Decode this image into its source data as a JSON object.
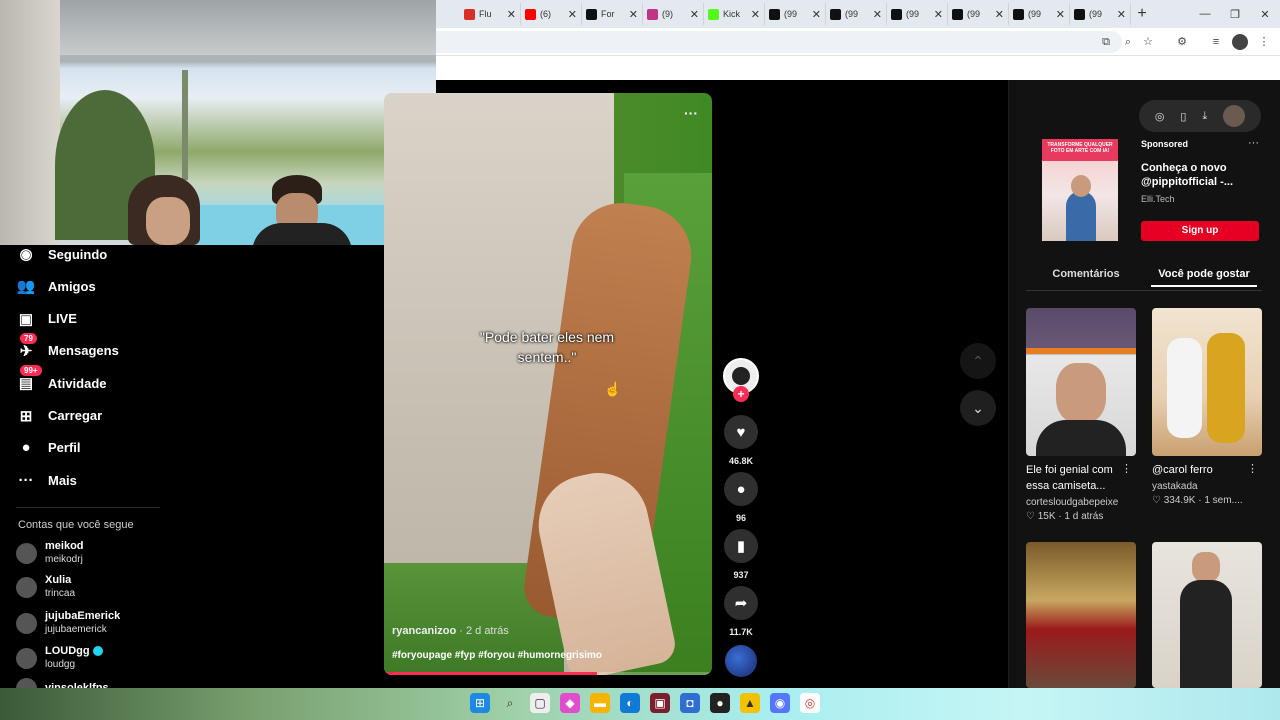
{
  "browser": {
    "tabs": [
      {
        "label": "Flu",
        "color": "#d93025"
      },
      {
        "label": "(6)",
        "color": "#ff0000"
      },
      {
        "label": "For",
        "color": "#111111"
      },
      {
        "label": "(9)",
        "color": "#c13584"
      },
      {
        "label": "Kick",
        "color": "#53fc18"
      },
      {
        "label": "(99",
        "color": "#111111"
      },
      {
        "label": "(99",
        "color": "#111111"
      },
      {
        "label": "(99",
        "color": "#111111"
      },
      {
        "label": "(99",
        "color": "#111111"
      },
      {
        "label": "(99",
        "color": "#111111"
      },
      {
        "label": "(99",
        "color": "#111111"
      }
    ],
    "close_glyph": "✕",
    "new_tab_glyph": "+"
  },
  "sidebar": {
    "nav": [
      {
        "label": "Seguindo",
        "icon": "following-icon",
        "glyph": "◉"
      },
      {
        "label": "Amigos",
        "icon": "friends-icon",
        "glyph": "👥"
      },
      {
        "label": "LIVE",
        "icon": "live-icon",
        "glyph": "▣"
      },
      {
        "label": "Mensagens",
        "icon": "messages-icon",
        "glyph": "✈",
        "badge": "79"
      },
      {
        "label": "Atividade",
        "icon": "activity-icon",
        "glyph": "▤",
        "badge": "99+"
      },
      {
        "label": "Carregar",
        "icon": "upload-icon",
        "glyph": "⊞"
      },
      {
        "label": "Perfil",
        "icon": "profile-icon",
        "glyph": "●"
      },
      {
        "label": "Mais",
        "icon": "more-icon",
        "glyph": "···"
      }
    ],
    "following_title": "Contas que você segue",
    "accounts": [
      {
        "name": "meikod",
        "handle": "meikodrj"
      },
      {
        "name": "Xulia",
        "handle": "trincaa"
      },
      {
        "name": "jujubaEmerick",
        "handle": "jujubaemerick"
      },
      {
        "name": "LOUDgg",
        "handle": "loudgg",
        "verified": true
      },
      {
        "name": "vinsoleklfps",
        "handle": ""
      }
    ]
  },
  "video": {
    "caption": "\"Pode bater eles nem sentem..\"",
    "author": "ryancanizoo",
    "age": "· 2 d atrás",
    "tags": "#foryoupage #fyp #foryou #humornegrisimo",
    "progress": 0.65,
    "more_glyph": "···"
  },
  "actions": {
    "likes": "46.8K",
    "comments": "96",
    "saves": "937",
    "shares": "11.7K"
  },
  "ad": {
    "sponsored": "Sponsored",
    "title": "Conheça o novo @pippitofficial -...",
    "subtitle": "Elli.Tech",
    "cta": "Sign up",
    "banner_text": "TRANSFORME QUALQUER FOTO EM ARTE COM IA!"
  },
  "right_tabs": {
    "comments": "Comentários",
    "suggested": "Você pode gostar"
  },
  "cards": [
    {
      "title": "Ele foi genial com essa camiseta...",
      "user": "cortesloudgabepeixe",
      "stats": "♡ 15K · 1 d atrás"
    },
    {
      "title": "@carol ferro",
      "user": "yastakada",
      "stats": "♡ 334.9K · 1 sem...."
    },
    {
      "title": "",
      "user": "",
      "stats": ""
    },
    {
      "title": "",
      "user": "",
      "stats": ""
    }
  ]
}
